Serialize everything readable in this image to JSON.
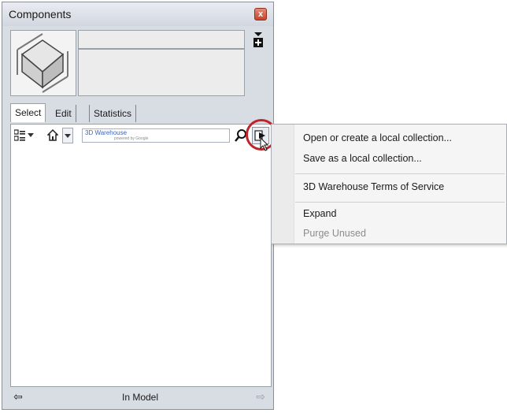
{
  "window": {
    "title": "Components",
    "close_label": "x"
  },
  "tabs": [
    {
      "label": "Select"
    },
    {
      "label": "Edit"
    },
    {
      "label": "Statistics"
    }
  ],
  "search": {
    "placeholder": "3D Warehouse",
    "sub": "powered by Google"
  },
  "status": {
    "text": "In Model"
  },
  "menu": {
    "items": [
      {
        "label": "Open or create a local collection..."
      },
      {
        "label": "Save as a local collection..."
      },
      {
        "label": "3D Warehouse Terms of Service"
      },
      {
        "label": "Expand"
      },
      {
        "label": "Purge Unused",
        "disabled": true
      }
    ]
  },
  "icons": {
    "create": "create-component-icon",
    "view": "view-options-icon",
    "home": "home-icon",
    "search": "search-icon",
    "details": "details-arrow-icon",
    "back": "back-arrow-icon",
    "forward": "forward-arrow-icon",
    "preview": "component-preview-cube"
  },
  "colors": {
    "highlight_ring": "#c0242a",
    "accent_text": "#3a64c8"
  }
}
